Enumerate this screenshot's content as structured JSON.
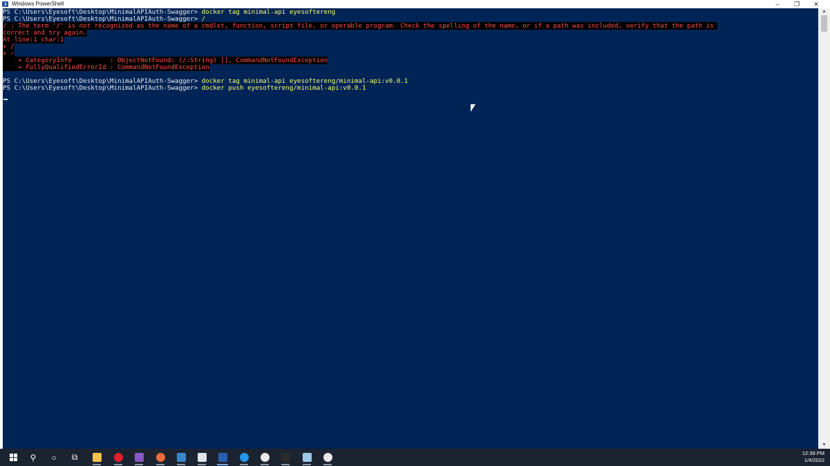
{
  "window": {
    "title": "Windows PowerShell",
    "controls": {
      "minimize": "–",
      "maximize": "❐",
      "close": "✕"
    }
  },
  "console": {
    "background": "#012456",
    "lines": [
      {
        "prompt": "PS C:\\Users\\Eyesoft\\Desktop\\MinimalAPIAuth-Swagger> ",
        "command": "docker tag minimal-api eyesoftereng"
      },
      {
        "prompt": "PS C:\\Users\\Eyesoft\\Desktop\\MinimalAPIAuth-Swagger> ",
        "command": "/"
      },
      {
        "error": "/ : The term '/' is not recognized as the name of a cmdlet, function, script file, or operable program. Check the spelling of the name, or if a path was included, verify that the path is "
      },
      {
        "error": "correct and try again."
      },
      {
        "error": "At line:1 char:1"
      },
      {
        "error": "+ /"
      },
      {
        "error": "+ ~"
      },
      {
        "error": "    + CategoryInfo          : ObjectNotFound: (/:String) [], CommandNotFoundException"
      },
      {
        "error": "    + FullyQualifiedErrorId : CommandNotFoundException"
      },
      {
        "blank": ""
      },
      {
        "prompt": "PS C:\\Users\\Eyesoft\\Desktop\\MinimalAPIAuth-Swagger> ",
        "command": "docker tag minimal-api eyesoftereng/minimal-api:v0.0.1"
      },
      {
        "prompt": "PS C:\\Users\\Eyesoft\\Desktop\\MinimalAPIAuth-Swagger> ",
        "command": "docker push eyesoftereng/minimal-api:v0.0.1"
      }
    ]
  },
  "taskbar": {
    "items": [
      {
        "name": "start-button",
        "icon": "windows-logo-icon",
        "color": "#ffffff"
      },
      {
        "name": "search-button",
        "icon": "search-icon",
        "glyph": "⚲",
        "color": "#ffffff"
      },
      {
        "name": "cortana-button",
        "icon": "cortana-icon",
        "glyph": "○",
        "color": "#ffffff"
      },
      {
        "name": "task-view-button",
        "icon": "task-view-icon",
        "glyph": "⧉",
        "color": "#ffffff"
      },
      {
        "name": "file-explorer-app",
        "icon": "folder-icon",
        "color": "#f2c14e"
      },
      {
        "name": "opera-app",
        "icon": "opera-icon",
        "color": "#e0202c"
      },
      {
        "name": "visual-studio-app",
        "icon": "visual-studio-icon",
        "color": "#8a58c6"
      },
      {
        "name": "postman-app",
        "icon": "postman-icon",
        "color": "#f26b3a"
      },
      {
        "name": "network-app",
        "icon": "network-icon",
        "color": "#3a86c8"
      },
      {
        "name": "notepad-app",
        "icon": "notepad-icon",
        "color": "#dfe4ea"
      },
      {
        "name": "powershell-app",
        "icon": "powershell-icon",
        "color": "#2a5fb0",
        "active": true
      },
      {
        "name": "docker-app",
        "icon": "docker-icon",
        "color": "#2496ed"
      },
      {
        "name": "slack-app",
        "icon": "slack-icon",
        "color": "#e9e9e9"
      },
      {
        "name": "terminal-app",
        "icon": "terminal-icon",
        "color": "#2b2b2b"
      },
      {
        "name": "notes-app",
        "icon": "notes-icon",
        "color": "#9fc8e8"
      },
      {
        "name": "github-app",
        "icon": "github-icon",
        "color": "#e9e9e9"
      }
    ],
    "clock": {
      "time": "12:39 PM",
      "date": "1/4/2022"
    }
  }
}
